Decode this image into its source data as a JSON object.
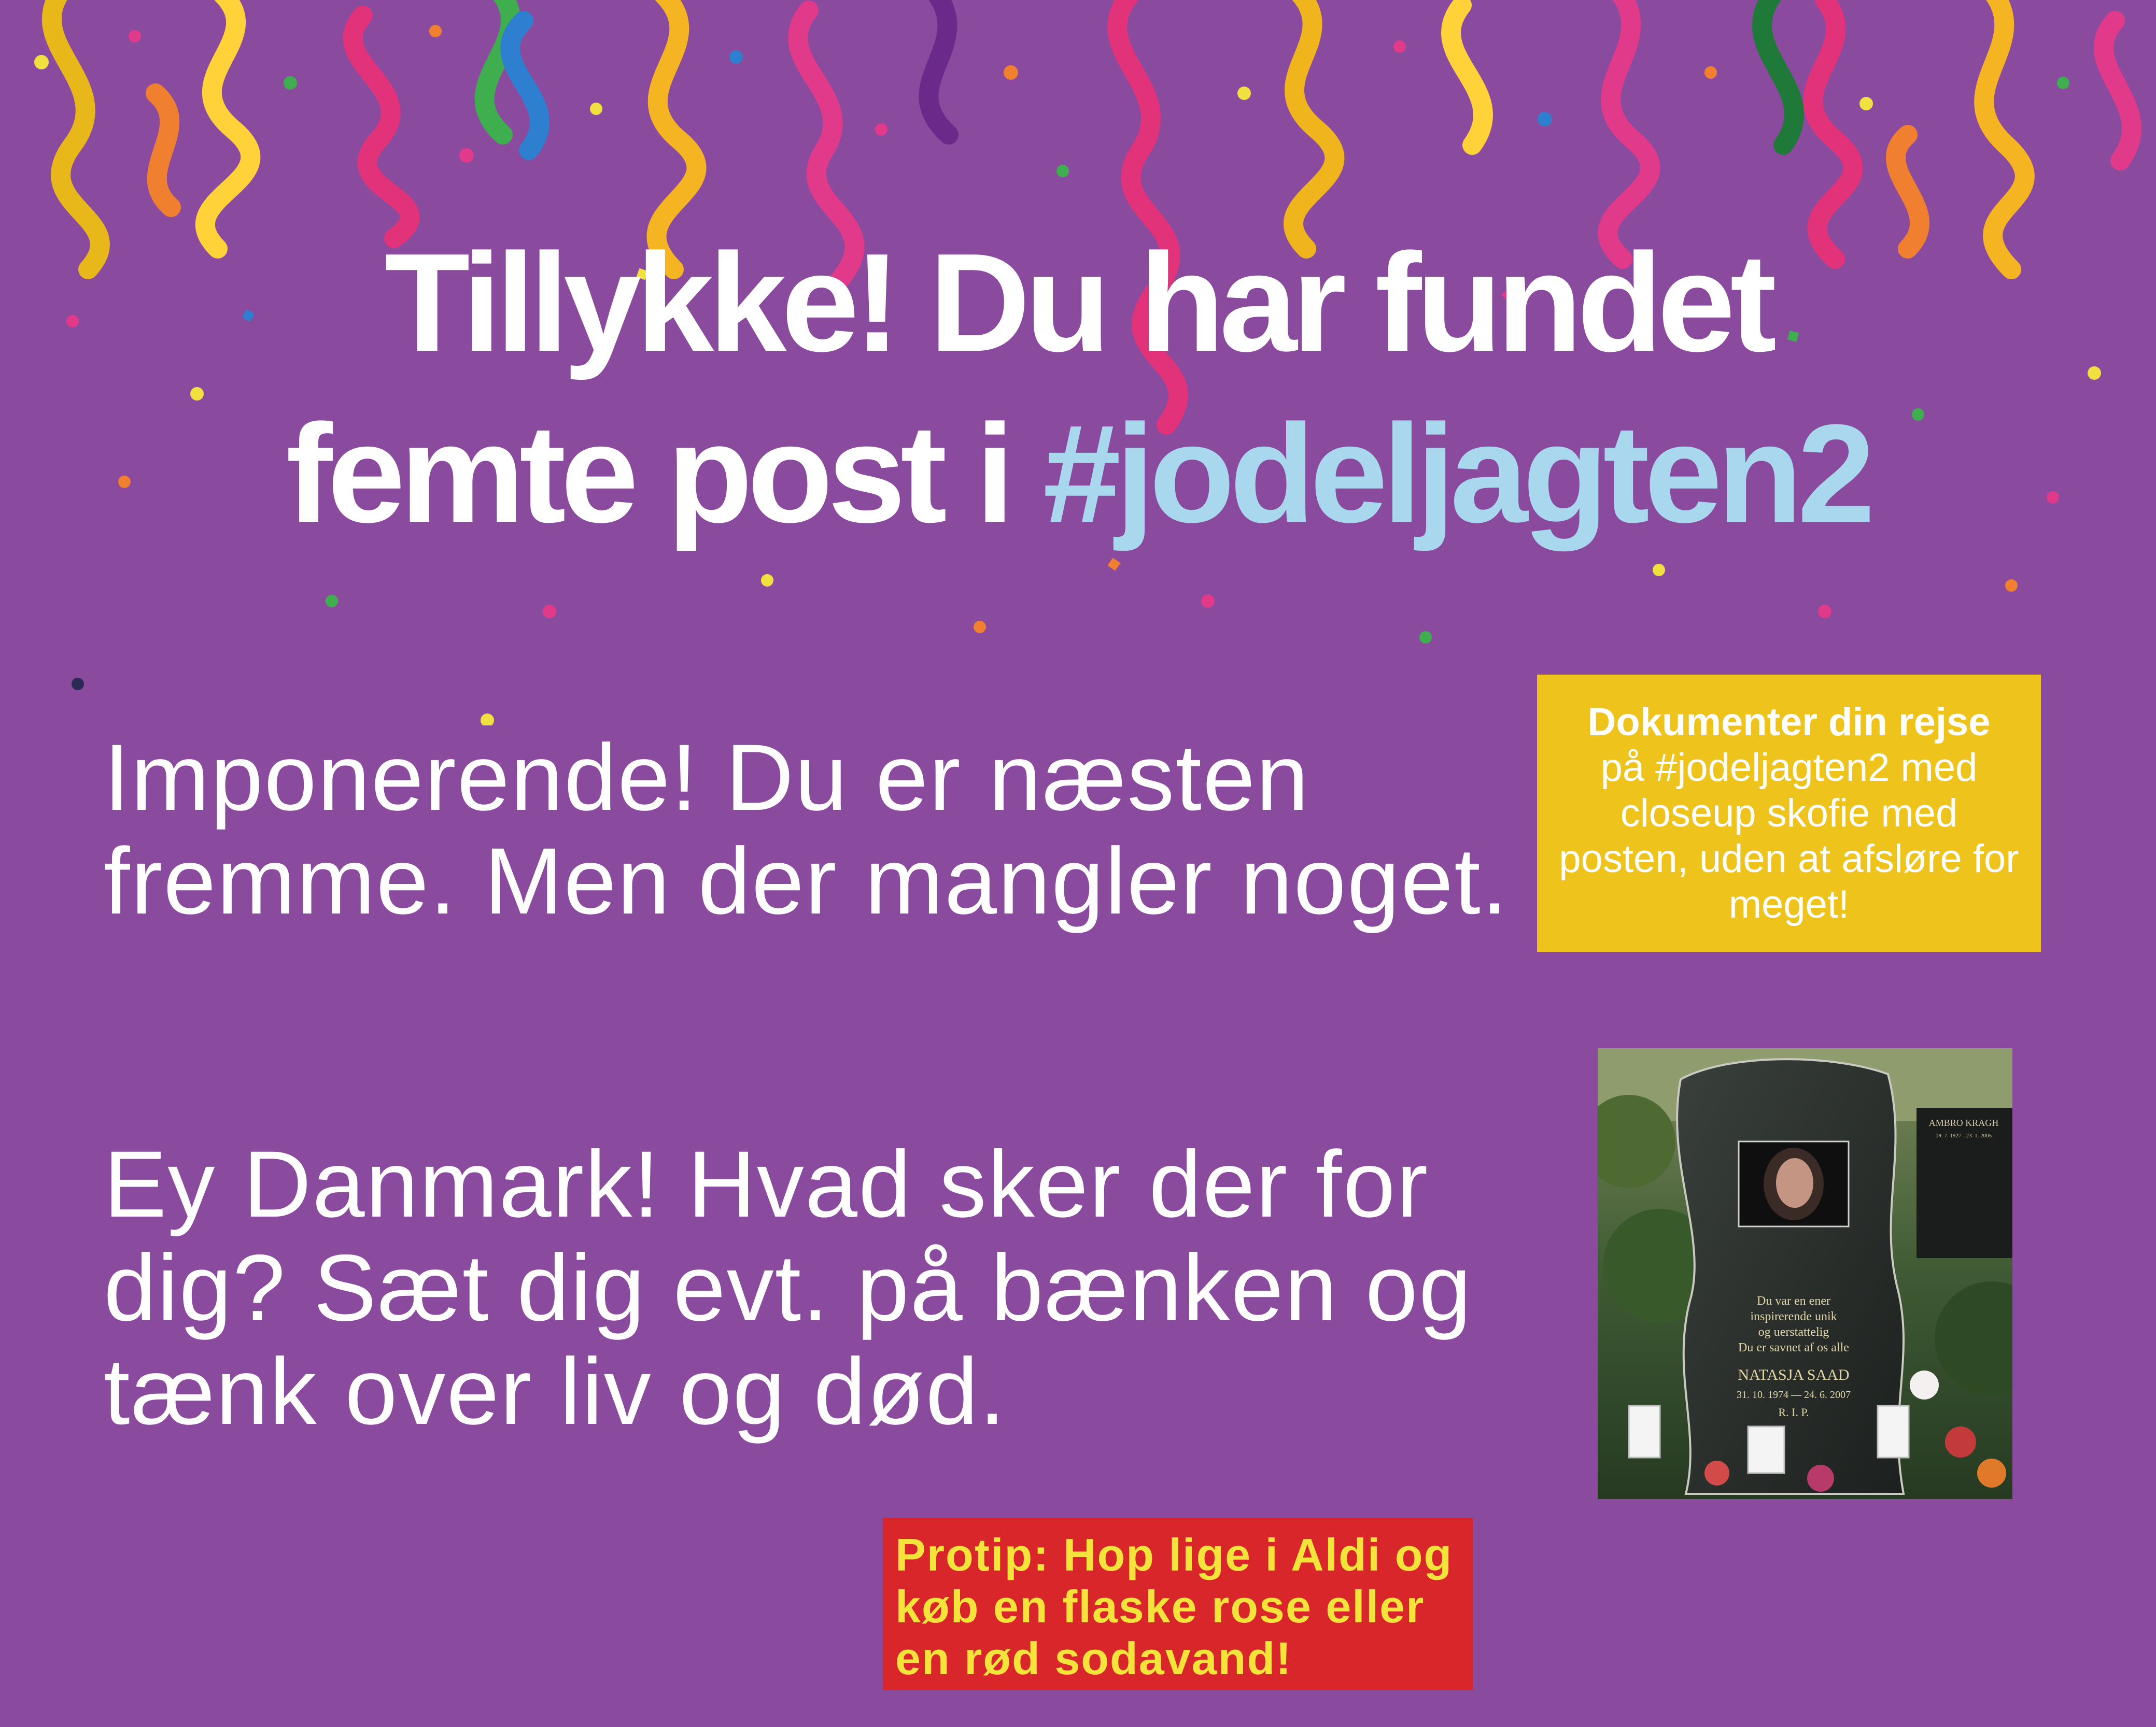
{
  "headline": {
    "line1": "Tillykke! Du har fundet",
    "line2_prefix": "femte post i ",
    "hashtag": "#jodeljagten2"
  },
  "body": {
    "paragraph1": "Imponerende! Du er næsten fremme. Men der mangler noget.",
    "paragraph2": "Ey Danmark! Hvad sker der for dig? Sæt dig evt. på bænken og tænk over liv og død."
  },
  "document_box": {
    "bold": "Dokumenter din rejse",
    "text": "på #jodeljagten2 med closeup skofie med posten, uden at afsløre for meget!"
  },
  "protip": {
    "text": "Protip: Hop lige i Aldi og køb en flaske rose eller en rød sodavand!"
  },
  "gravestone": {
    "plaque_name": "AMBRO KRAGH",
    "plaque_dates": "19. 7. 1927 - 23. 1. 2005",
    "inscription": [
      "Du var en ener",
      "inspirerende unik",
      "og uerstattelig",
      "Du er savnet af os alle"
    ],
    "name": "NATASJA  SAAD",
    "dates": "31. 10. 1974  —  24. 6. 2007",
    "rip": "R. I. P."
  },
  "colors": {
    "background": "#8a4a9e",
    "hashtag": "#a9d8ee",
    "doc_box": "#eec31c",
    "protip_box": "#d8262b",
    "protip_text": "#f4e33a"
  }
}
